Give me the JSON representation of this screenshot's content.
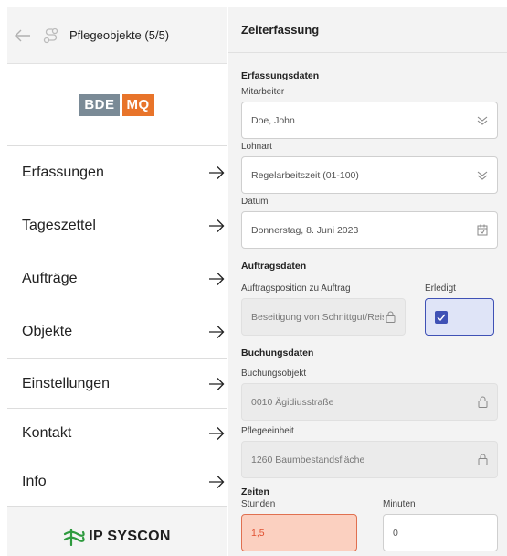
{
  "sidebar": {
    "header_title": "Pflegeobjekte (5/5)",
    "logo": {
      "left": "BDE",
      "right": "MQ",
      "left_color": "#7a8a96",
      "right_color": "#e8742a"
    },
    "menu_group_1": [
      {
        "label": "Erfassungen",
        "icon": "arrow-right-icon"
      },
      {
        "label": "Tageszettel",
        "icon": "arrow-right-icon"
      },
      {
        "label": "Aufträge",
        "icon": "arrow-right-icon"
      },
      {
        "label": "Objekte",
        "icon": "arrow-right-icon"
      }
    ],
    "menu_group_2": [
      {
        "label": "Einstellungen",
        "icon": "arrow-right-icon"
      }
    ],
    "menu_group_3": [
      {
        "label": "Kontakt",
        "icon": "arrow-right-icon"
      },
      {
        "label": "Info",
        "icon": "arrow-right-icon"
      }
    ],
    "footer_brand": "IP SYSCON"
  },
  "panel": {
    "title": "Zeiterfassung",
    "erfassungsdaten": {
      "title": "Erfassungsdaten",
      "mitarbeiter_label": "Mitarbeiter",
      "mitarbeiter_value": "Doe, John",
      "lohnart_label": "Lohnart",
      "lohnart_value": "Regelarbeitszeit (01-100)",
      "datum_label": "Datum",
      "datum_value": "Donnerstag, 8. Juni 2023"
    },
    "auftragsdaten": {
      "title": "Auftragsdaten",
      "position_label": "Auftragsposition zu Auftrag",
      "position_value": "Beseitigung von Schnittgut/Reis",
      "erledigt_label": "Erledigt",
      "erledigt_checked": true
    },
    "buchungsdaten": {
      "title": "Buchungsdaten",
      "objekt_label": "Buchungsobjekt",
      "objekt_value": "0010 Ägidiusstraße",
      "einheit_label": "Pflegeeinheit",
      "einheit_value": "1260 Baumbestandsfläche"
    },
    "zeiten": {
      "title": "Zeiten",
      "stunden_label": "Stunden",
      "stunden_value": "1,5",
      "minuten_label": "Minuten",
      "minuten_value": "0"
    }
  },
  "colors": {
    "accent": "#3f51b5",
    "error_bg": "#fbd0c0",
    "error_text": "#e05030"
  }
}
